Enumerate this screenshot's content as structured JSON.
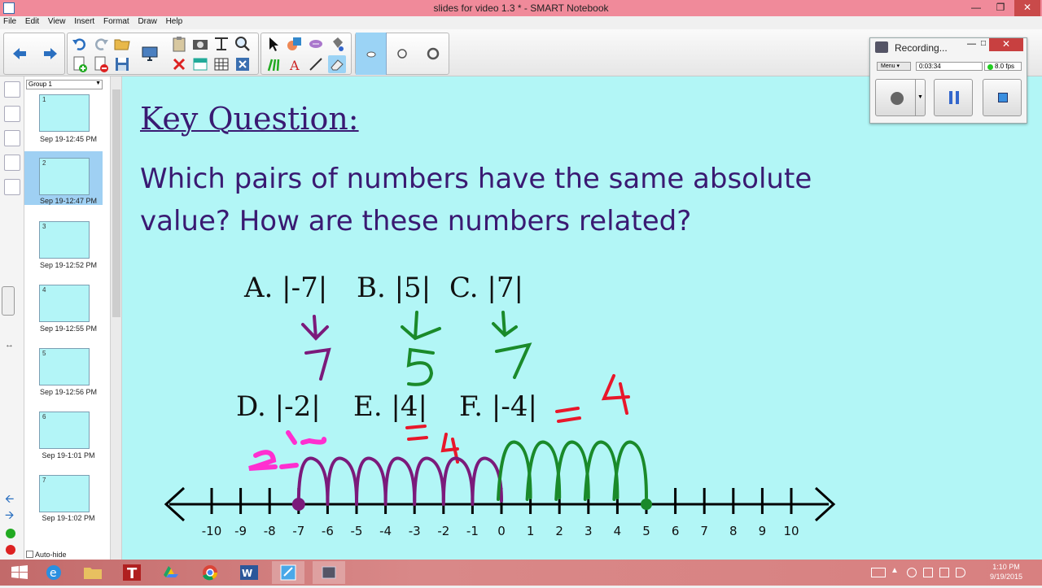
{
  "window": {
    "title": "slides for video 1.3 * - SMART Notebook"
  },
  "menu": [
    "File",
    "Edit",
    "View",
    "Insert",
    "Format",
    "Draw",
    "Help"
  ],
  "sorter": {
    "group_label": "Group 1",
    "autohide_label": "Auto-hide",
    "pages": [
      {
        "num": "1",
        "label": "Sep 19-12:45 PM"
      },
      {
        "num": "2",
        "label": "Sep 19-12:47 PM"
      },
      {
        "num": "3",
        "label": "Sep 19-12:52 PM"
      },
      {
        "num": "4",
        "label": "Sep 19-12:55 PM"
      },
      {
        "num": "5",
        "label": "Sep 19-12:56 PM"
      },
      {
        "num": "6",
        "label": "Sep 19-1:01 PM"
      },
      {
        "num": "7",
        "label": "Sep 19-1:02 PM"
      }
    ]
  },
  "slide": {
    "heading": "Key Question:",
    "question_line1": "Which pairs of numbers have the same absolute",
    "question_line2": "value? How are these numbers related?",
    "options": {
      "a": "A.  |-7|",
      "b": "B.  |5|",
      "c": "C.  |7|",
      "d": "D.  |-2|",
      "e": "E.  |4|",
      "f": "F.  |-4|"
    },
    "number_line": [
      "-10",
      "-9",
      "-8",
      "-7",
      "-6",
      "-5",
      "-4",
      "-3",
      "-2",
      "-1",
      "0",
      "1",
      "2",
      "3",
      "4",
      "5",
      "6",
      "7",
      "8",
      "9",
      "10"
    ],
    "ink_colors": {
      "purple": "#7b1a7b",
      "green": "#1a8a2a",
      "red": "#e8172a",
      "magenta": "#ff2fd0"
    }
  },
  "recorder": {
    "title": "Recording...",
    "menu_label": "Menu",
    "elapsed": "0:03:34",
    "fps": "8.0 fps"
  },
  "taskbar": {
    "time": "1:10 PM",
    "date": "9/19/2015"
  }
}
